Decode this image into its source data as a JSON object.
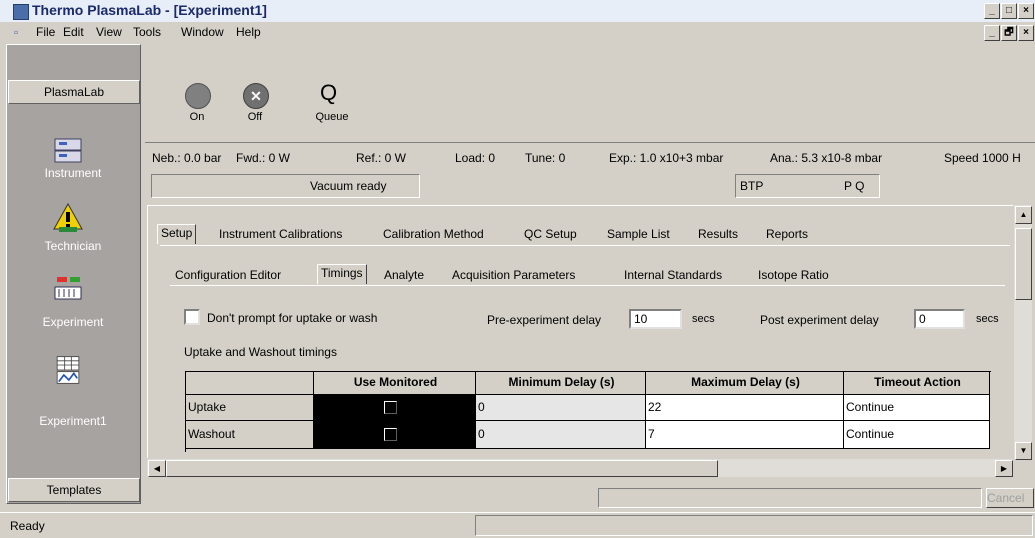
{
  "window": {
    "title": "Thermo PlasmaLab - [Experiment1]",
    "min_label": "_",
    "max_label": "□",
    "restore_label": "🗗",
    "close_label": "×"
  },
  "menu": [
    "File",
    "Edit",
    "View",
    "Tools",
    "Window",
    "Help"
  ],
  "sidebar": {
    "header": "PlasmaLab",
    "items": [
      {
        "label": "Instrument",
        "icon": "instrument-icon"
      },
      {
        "label": "Technician",
        "icon": "technician-icon"
      },
      {
        "label": "Experiment",
        "icon": "experiment-icon"
      },
      {
        "label": "Experiment1",
        "icon": "experiment1-icon"
      }
    ],
    "footer": "Templates"
  },
  "toolbar": {
    "on_label": "On",
    "off_label": "Off",
    "queue_label": "Queue"
  },
  "status": {
    "neb": "Neb.: 0.0 bar",
    "fwd": "Fwd.: 0 W",
    "ref": "Ref.: 0 W",
    "load": "Load: 0",
    "tune": "Tune: 0",
    "exp": "Exp.: 1.0 x10+3 mbar",
    "ana": "Ana.: 5.3 x10-8 mbar",
    "speed": "Speed 1000 H",
    "vacuum": "Vacuum ready",
    "btp": "BTP",
    "pq": "P Q"
  },
  "tabs_main": [
    "Setup",
    "Instrument Calibrations",
    "Calibration Method",
    "QC Setup",
    "Sample List",
    "Results",
    "Reports"
  ],
  "tabs_sub": [
    "Configuration Editor",
    "Timings",
    "Analyte",
    "Acquisition Parameters",
    "Internal Standards",
    "Isotope Ratio"
  ],
  "timings": {
    "dont_prompt_label": "Don't prompt for uptake or wash",
    "pre_delay_label": "Pre-experiment delay",
    "pre_delay_value": "10",
    "pre_delay_unit": "secs",
    "post_delay_label": "Post experiment delay",
    "post_delay_value": "0",
    "post_delay_unit": "secs",
    "group_label": "Uptake and Washout timings"
  },
  "grid": {
    "columns": [
      "Use Monitored",
      "Minimum Delay (s)",
      "Maximum Delay (s)",
      "Timeout Action"
    ],
    "rows": [
      {
        "name": "Uptake",
        "min": "0",
        "max": "22",
        "action": "Continue"
      },
      {
        "name": "Washout",
        "min": "0",
        "max": "7",
        "action": "Continue"
      }
    ]
  },
  "cancel_label": "Cancel",
  "statusbar": {
    "text": "Ready"
  }
}
